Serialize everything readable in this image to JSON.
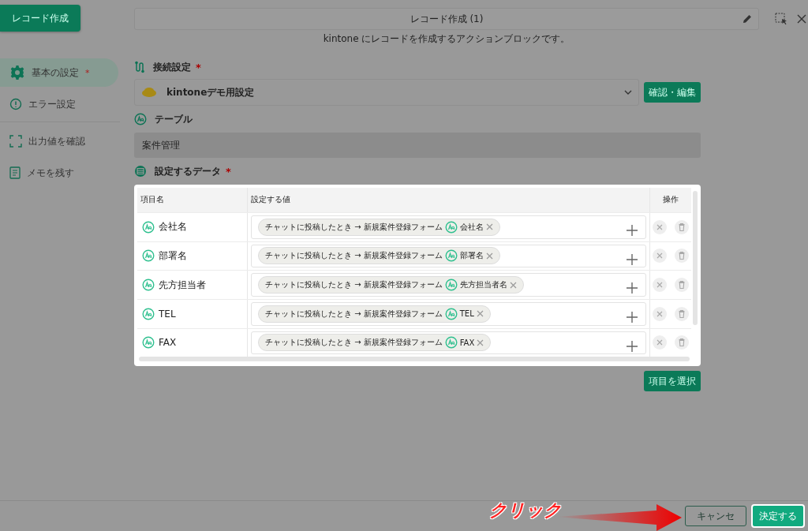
{
  "header_button": "レコード作成",
  "title": "レコード作成 (1)",
  "subtitle": "kintone にレコードを作成するアクションブロックです。",
  "sidebar": {
    "items": [
      {
        "label": "基本の設定",
        "required_mark": "*",
        "selected": true,
        "kind": "gear"
      },
      {
        "label": "エラー設定",
        "selected": false,
        "kind": "alert"
      },
      {
        "label": "出力値を確認",
        "selected": false,
        "kind": "frame"
      },
      {
        "label": "メモを残す",
        "selected": false,
        "kind": "note"
      }
    ]
  },
  "connection": {
    "label": "接続設定",
    "required_mark": "*",
    "value": "kintoneデモ用設定",
    "button": "確認・編集"
  },
  "table_setting": {
    "label": "テーブル",
    "value": "案件管理"
  },
  "data": {
    "label": "設定するデータ",
    "required_mark": "*",
    "columns": [
      "項目名",
      "設定する値",
      "操作"
    ],
    "rows": [
      {
        "name": "会社名",
        "chips": [
          {
            "source": "チャットに投稿したとき → 新規案件登録フォーム",
            "field": "会社名"
          }
        ]
      },
      {
        "name": "部署名",
        "chips": [
          {
            "source": "チャットに投稿したとき → 新規案件登録フォーム",
            "field": "部署名"
          }
        ]
      },
      {
        "name": "先方担当者",
        "chips": [
          {
            "source": "チャットに投稿したとき → 新規案件登録フォーム",
            "field": "先方担当者名"
          }
        ]
      },
      {
        "name": "TEL",
        "chips": [
          {
            "source": "チャットに投稿したとき → 新規案件登録フォーム",
            "field": "TEL"
          }
        ]
      },
      {
        "name": "FAX",
        "chips": [
          {
            "source": "チャットに投稿したとき → 新規案件登録フォーム",
            "field": "FAX"
          }
        ]
      }
    ],
    "select_button": "項目を選択"
  },
  "footer": {
    "cancel": "キャンセ",
    "confirm": "決定する"
  },
  "annotation": {
    "text": "クリック"
  }
}
